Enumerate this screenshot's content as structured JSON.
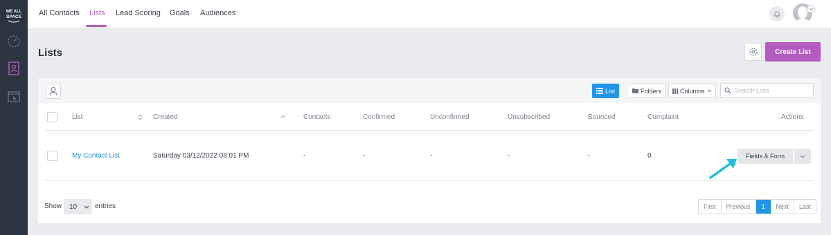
{
  "brand": {
    "logo_text": "WE ALL SPACE",
    "accent": "#b45bbf",
    "link_color": "#2196e8"
  },
  "sidebar": {
    "items": [
      {
        "icon": "speedometer-icon"
      },
      {
        "icon": "contacts-book-icon",
        "active": true
      },
      {
        "icon": "browser-cursor-icon"
      }
    ]
  },
  "topnav": {
    "tabs": [
      "All Contacts",
      "Lists",
      "Lead Scoring",
      "Goals",
      "Audiences"
    ],
    "active_tab": "Lists"
  },
  "page": {
    "title": "Lists",
    "create_button": "Create List"
  },
  "toolbar": {
    "list_view": "List",
    "folders": "Folders",
    "columns": "Columns",
    "search_placeholder": "Search Lists"
  },
  "table": {
    "columns": [
      "List",
      "Created",
      "Contacts",
      "Confirmed",
      "Unconfirmed",
      "Unsubscribed",
      "Bounced",
      "Complaint",
      "Actions"
    ],
    "rows": [
      {
        "list": "My Contact List",
        "created": "Saturday 03/12/2022 08:01 PM",
        "contacts": "-",
        "confirmed": "-",
        "unconfirmed": "-",
        "unsubscribed": "-",
        "bounced": "-",
        "complaint": "0",
        "action": "Fields & Form"
      }
    ]
  },
  "footer": {
    "show_label": "Show",
    "entries_value": "10",
    "entries_label": "entries",
    "pager": [
      "First",
      "Previous",
      "1",
      "Next",
      "Last"
    ],
    "current_page": "1"
  }
}
